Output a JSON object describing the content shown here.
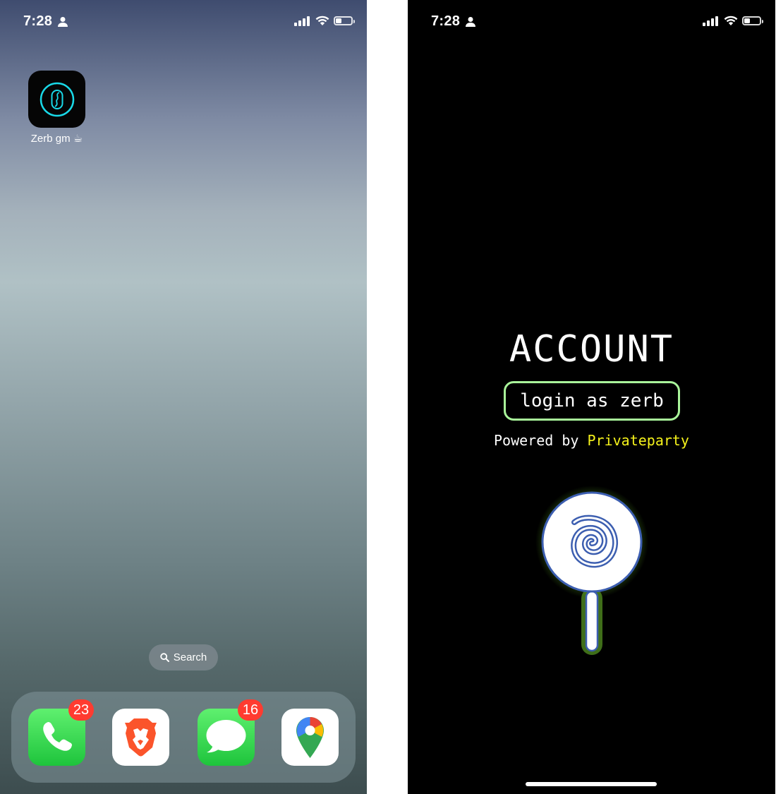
{
  "left_screen": {
    "status_bar": {
      "time": "7:28",
      "icons": [
        "person-icon",
        "signal-icon",
        "wifi-icon",
        "battery-icon"
      ],
      "battery_level": 0.3
    },
    "home_apps": [
      {
        "label": "Zerb gm ☕",
        "icon": "zerb-app-icon"
      }
    ],
    "search_pill": {
      "label": "Search",
      "icon": "search-icon"
    },
    "dock": [
      {
        "name": "Phone",
        "icon": "phone-app-icon",
        "badge": "23"
      },
      {
        "name": "Brave",
        "icon": "brave-app-icon"
      },
      {
        "name": "Messages",
        "icon": "messages-app-icon",
        "badge": "16"
      },
      {
        "name": "Google Maps",
        "icon": "maps-app-icon"
      }
    ]
  },
  "right_screen": {
    "status_bar": {
      "time": "7:28",
      "battery_level": 0.3
    },
    "title": "ACCOUNT",
    "login_button": "login as zerb",
    "powered_prefix": "Powered by",
    "powered_brand": "Privateparty",
    "logo": "lollipop-icon"
  },
  "colors": {
    "accent_green": "#a9f59a",
    "brand_yellow": "#f5f21b",
    "badge_red": "#ff3b30",
    "zerb_cyan": "#19d9e8"
  }
}
